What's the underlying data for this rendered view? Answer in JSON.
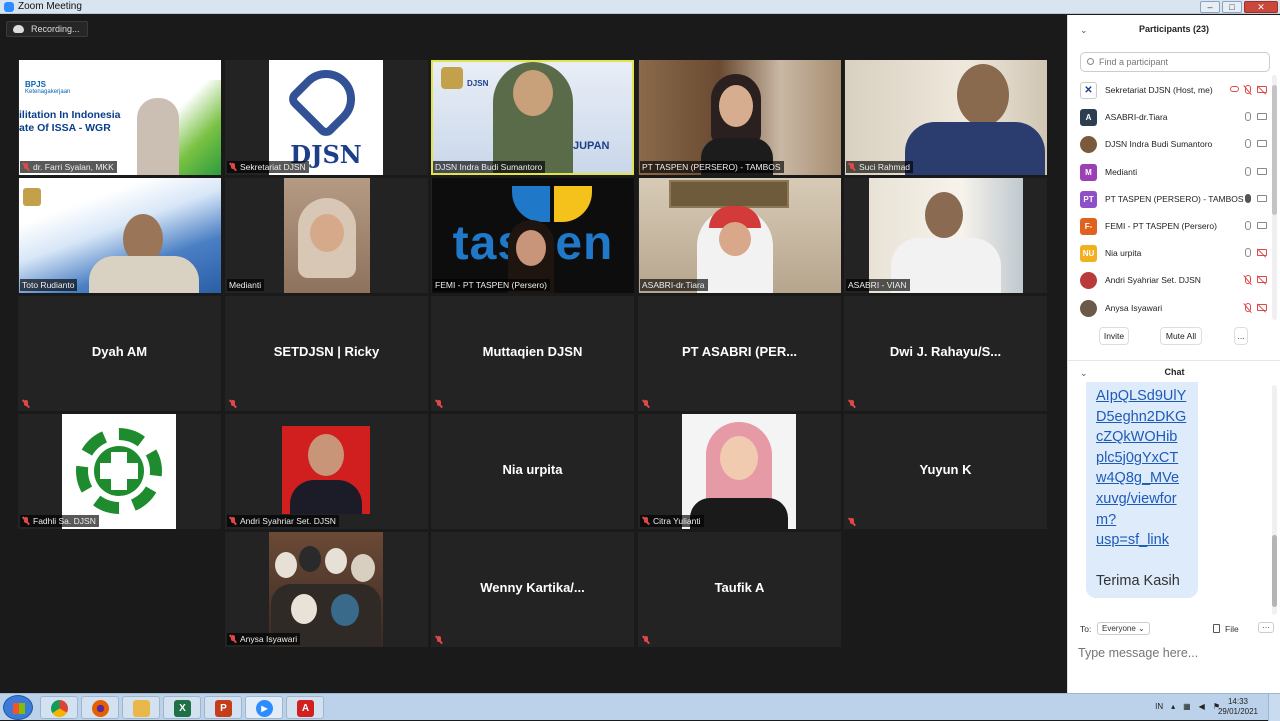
{
  "window": {
    "title": "Zoom Meeting",
    "minimize": "–",
    "maximize": "□",
    "close": "✕"
  },
  "recording": {
    "label": "Recording..."
  },
  "gallery": {
    "video_tiles": [
      {
        "name": "dr. Farri Syalan, MKK",
        "slide_line1": "BPJS",
        "slide_line2": "Ketenagakerjaan",
        "slide_line3": "ilitation In Indonesia",
        "slide_line4": "ate Of ISSA - WGR"
      },
      {
        "name": "Sekretariat DJSN",
        "logo_text": "DJSN"
      },
      {
        "name": "DJSN Indra Budi Sumantoro",
        "slide_text": "DJSN",
        "slide_sub": "JUPAN"
      },
      {
        "name": "PT TASPEN (PERSERO) - TAMBOS"
      },
      {
        "name": "Suci Rahmad"
      },
      {
        "name": "Toto Rudianto"
      },
      {
        "name": "Medianti"
      },
      {
        "name": "FEMI - PT TASPEN (Persero)",
        "bg_text": "taspen"
      },
      {
        "name": "ASABRI-dr.Tiara"
      },
      {
        "name": "ASABRI - VIAN"
      }
    ],
    "name_tiles": [
      {
        "name": "Dyah AM"
      },
      {
        "name": "SETDJSN | Ricky"
      },
      {
        "name": "Muttaqien DJSN"
      },
      {
        "name": "PT ASABRI  (PER..."
      },
      {
        "name": "Dwi J. Rahayu/S..."
      },
      {
        "name": "Nia urpita"
      },
      {
        "name": "Yuyun K"
      },
      {
        "name": "Wenny  Kartika/..."
      },
      {
        "name": "Taufik A"
      }
    ],
    "photo_tiles": [
      {
        "name": "Fadhli Sa. DJSN"
      },
      {
        "name": "Andri Syahriar Set. DJSN"
      },
      {
        "name": "Citra Yulianti"
      },
      {
        "name": "Anysa Isyawari"
      }
    ]
  },
  "participants": {
    "title": "Participants (23)",
    "search_placeholder": "Find a participant",
    "list": [
      {
        "name": "Sekretariat DJSN (Host, me)",
        "avatar": "",
        "color": "#ffffff"
      },
      {
        "name": "ASABRI-dr.Tiara",
        "avatar": "A",
        "color": "#2c3e50"
      },
      {
        "name": "DJSN Indra Budi Sumantoro",
        "avatar": "",
        "color": "#7a5a3a"
      },
      {
        "name": "Medianti",
        "avatar": "M",
        "color": "#9b3fb5"
      },
      {
        "name": "PT TASPEN (PERSERO) - TAMBOS",
        "avatar": "PT",
        "color": "#8e4fc7"
      },
      {
        "name": "FEMI - PT TASPEN (Persero)",
        "avatar": "F-",
        "color": "#e0621f"
      },
      {
        "name": "Nia urpita",
        "avatar": "NU",
        "color": "#f2b01e"
      },
      {
        "name": "Andri Syahriar Set. DJSN",
        "avatar": "",
        "color": "#b83a3a"
      },
      {
        "name": "Anysa Isyawari",
        "avatar": "",
        "color": "#6b5a4a"
      }
    ],
    "invite": "Invite",
    "mute_all": "Mute All",
    "more": "..."
  },
  "chat": {
    "title": "Chat",
    "link_lines": [
      "AIpQLSd9UlY",
      "D5eghn2DKG",
      "cZQkWOHib",
      "plc5j0gYxCT",
      "w4Q8g_MVe",
      "xuvg/viewfor",
      "m?",
      "usp=sf_link"
    ],
    "message": "Terima Kasih",
    "to_label": "To:",
    "recipient": "Everyone ⌄",
    "file_label": "File",
    "more": "···",
    "input_placeholder": "Type message here..."
  },
  "taskbar": {
    "apps": [
      {
        "name": "chrome",
        "glyph": "",
        "color": "#db4437"
      },
      {
        "name": "firefox",
        "glyph": "",
        "color": "#e66000"
      },
      {
        "name": "explorer",
        "glyph": "",
        "color": "#e8b84a"
      },
      {
        "name": "excel",
        "glyph": "X",
        "color": "#1e7145"
      },
      {
        "name": "powerpoint",
        "glyph": "P",
        "color": "#c43e1c"
      },
      {
        "name": "zoom",
        "glyph": "▶",
        "color": "#2d8cff"
      },
      {
        "name": "acrobat",
        "glyph": "A",
        "color": "#d21f1f"
      }
    ],
    "lang": "IN",
    "time": "14:33",
    "date": "29/01/2021"
  }
}
